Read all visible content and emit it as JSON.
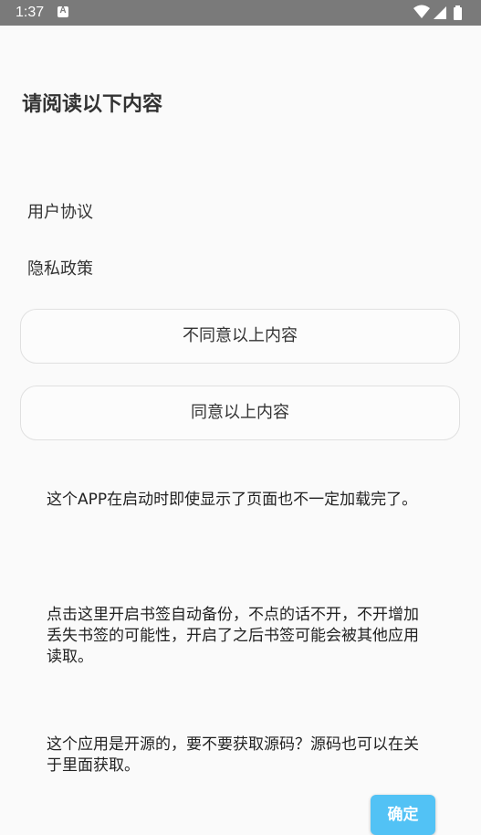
{
  "status_bar": {
    "time": "1:37",
    "notification_icon": "a-icon",
    "icons": [
      "wifi-icon",
      "signal-icon",
      "battery-icon"
    ]
  },
  "dialog": {
    "title": "请阅读以下内容",
    "links": [
      {
        "label": "用户协议"
      },
      {
        "label": "隐私政策"
      }
    ],
    "disagree_label": "不同意以上内容",
    "agree_label": "同意以上内容",
    "info": [
      "这个APP在启动时即使显示了页面也不一定加载完了。",
      "点击这里开启书签自动备份，不点的话不开，不开增加丢失书签的可能性，开启了之后书签可能会被其他应用读取。",
      "这个应用是开源的，要不要获取源码？源码也可以在关于里面获取。"
    ],
    "confirm_label": "确定"
  },
  "colors": {
    "status_bar_bg": "#7a7a7a",
    "page_bg": "#fafafa",
    "confirm_bg": "#52c2f5"
  }
}
